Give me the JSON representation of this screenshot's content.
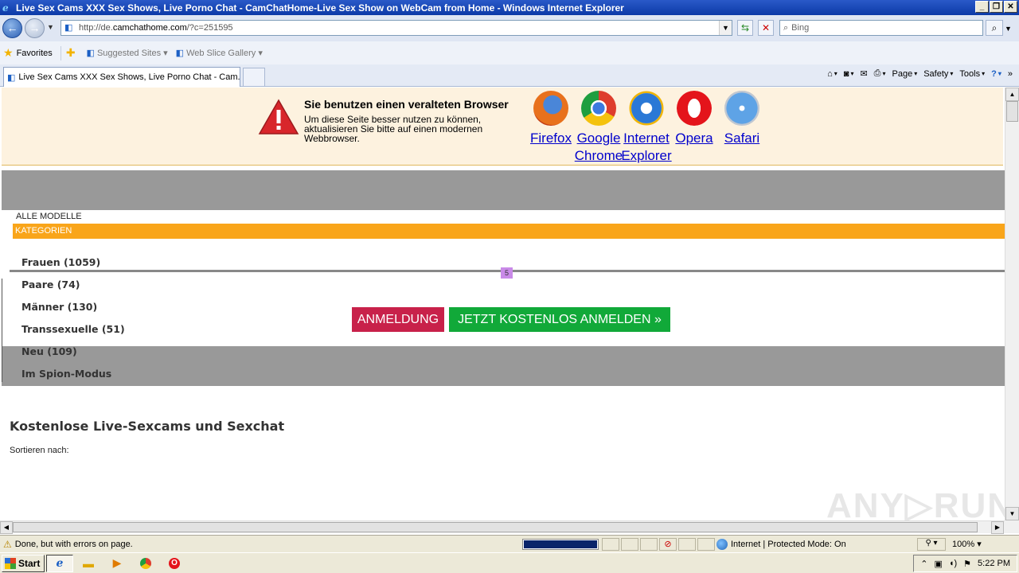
{
  "window": {
    "title": "Live Sex Cams XXX Sex Shows, Live Porno Chat - CamChatHome-Live Sex Show on WebCam from Home - Windows Internet Explorer"
  },
  "address": {
    "url_prefix": "http://de.",
    "url_domain": "camchathome.com",
    "url_rest": "/?c=251595",
    "search_placeholder": "Bing"
  },
  "favorites": {
    "favorites_label": "Favorites",
    "suggested_label": "Suggested Sites",
    "webslice_label": "Web Slice Gallery"
  },
  "tabs": {
    "active_tab": "Live Sex Cams XXX Sex Shows, Live Porno Chat - Cam...",
    "commands": [
      "Page",
      "Safety",
      "Tools"
    ]
  },
  "banner": {
    "title": "Sie benutzen einen veralteten Browser",
    "body": "Um diese Seite besser nutzen zu können, aktualisieren Sie bitte auf einen modernen Webbrowser.",
    "browsers": [
      "Firefox",
      "Google Chrome",
      "Internet Explorer",
      "Opera",
      "Safari"
    ]
  },
  "nav": {
    "all_models": "ALLE MODELLE",
    "categories": "KATEGORIEN",
    "items": [
      "Frauen (1059)",
      "Paare (74)",
      "Männer (130)",
      "Transsexuelle (51)",
      "Neu (109)",
      "Im Spion-Modus"
    ],
    "marker": "5"
  },
  "buttons": {
    "login": "ANMELDUNG",
    "signup": "JETZT KOSTENLOS ANMELDEN »"
  },
  "content": {
    "headline": "Kostenlose Live-Sexcams und Sexchat",
    "sort_label": "Sortieren nach:"
  },
  "watermark": "ANY RUN",
  "status": {
    "text": "Done, but with errors on page.",
    "progress": 1.0,
    "zone": "Internet | Protected Mode: On",
    "zoom": "100%"
  },
  "taskbar": {
    "start": "Start",
    "clock": "5:22 PM"
  },
  "colors": {
    "banner_bg": "#fdf2df",
    "kategorien_bg": "#f9a51a",
    "login_bg": "#c8214a",
    "signup_bg": "#11a939",
    "grey_band": "#999999"
  }
}
